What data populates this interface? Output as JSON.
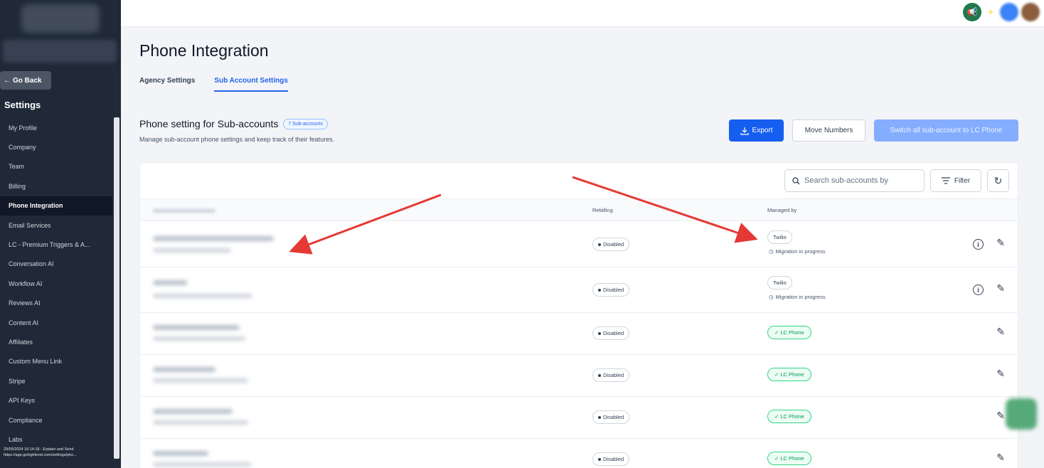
{
  "sidebar": {
    "go_back": "Go Back",
    "settings_title": "Settings",
    "items": [
      {
        "label": "My Profile"
      },
      {
        "label": "Company"
      },
      {
        "label": "Team"
      },
      {
        "label": "Billing"
      },
      {
        "label": "Phone Integration",
        "active": true
      },
      {
        "label": "Email Services"
      },
      {
        "label": "LC - Premium Triggers & A..."
      },
      {
        "label": "Conversation AI"
      },
      {
        "label": "Workflow AI"
      },
      {
        "label": "Reviews AI"
      },
      {
        "label": "Content AI"
      },
      {
        "label": "Affiliates"
      },
      {
        "label": "Custom Menu Link"
      },
      {
        "label": "Stripe"
      },
      {
        "label": "API Keys"
      },
      {
        "label": "Compliance"
      },
      {
        "label": "Labs"
      }
    ],
    "footer_line1": "29/05/2024 16:14:18 - Explain and Send",
    "footer_line2": "https://app.gohighlevel.com/settings/pho..."
  },
  "page": {
    "title": "Phone Integration",
    "tabs": [
      {
        "label": "Agency Settings",
        "active": false
      },
      {
        "label": "Sub Account Settings",
        "active": true
      }
    ],
    "section_title": "Phone setting for Sub-accounts",
    "count_badge": "7 Sub-accounts",
    "section_subtitle": "Manage sub-account phone settings and keep track of their features."
  },
  "actions": {
    "export": "Export",
    "move_numbers": "Move Numbers",
    "switch_all": "Switch all sub-account to LC Phone"
  },
  "table": {
    "search_placeholder": "Search sub-accounts by",
    "filter_label": "Filter",
    "columns": {
      "rebilling": "Rebilling",
      "managed_by": "Managed by"
    },
    "rows": [
      {
        "rebilling": "Disabled",
        "managed_by": "Twilio",
        "status": "Migration in progress",
        "info": true
      },
      {
        "rebilling": "Disabled",
        "managed_by": "Twilio",
        "status": "Migration in progress",
        "info": true
      },
      {
        "rebilling": "Disabled",
        "managed_by": "LC Phone"
      },
      {
        "rebilling": "Disabled",
        "managed_by": "LC Phone"
      },
      {
        "rebilling": "Disabled",
        "managed_by": "LC Phone"
      },
      {
        "rebilling": "Disabled",
        "managed_by": "LC Phone"
      }
    ]
  },
  "colors": {
    "sidebar_bg": "#1f2937",
    "primary": "#155eef",
    "primary_disabled": "#84adff",
    "success": "#039855",
    "annotation_arrow": "#e53935"
  },
  "icons": [
    "back-arrow-icon",
    "megaphone-icon",
    "download-icon",
    "search-icon",
    "filter-icon",
    "refresh-icon",
    "info-icon",
    "pencil-icon",
    "clock-icon",
    "check-icon"
  ]
}
